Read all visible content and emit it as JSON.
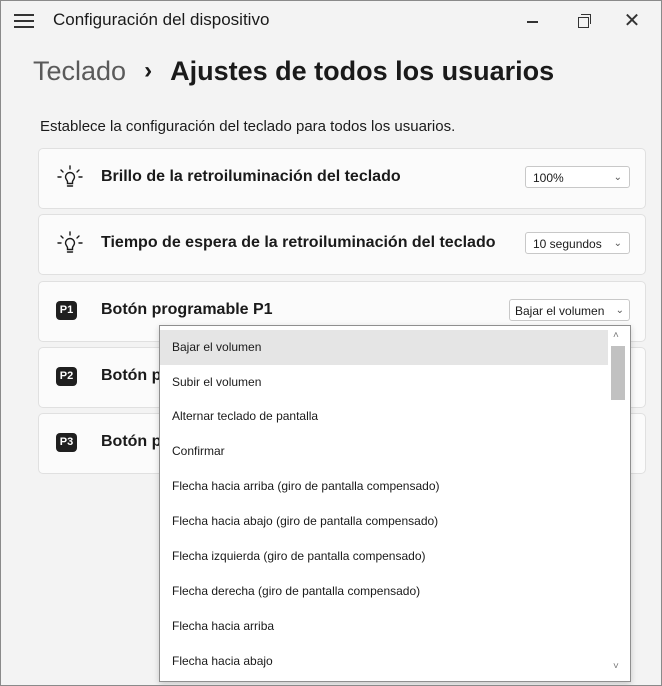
{
  "titlebar": {
    "app_title": "Configuración del dispositivo",
    "minimize_glyph": "–",
    "close_glyph": "✕"
  },
  "breadcrumb": {
    "parent": "Teclado",
    "separator": "›",
    "current": "Ajustes de todos los usuarios"
  },
  "description": "Establece la configuración del teclado para todos los usuarios.",
  "settings": [
    {
      "icon": "lightbulb-icon",
      "label": "Brillo de la retroiluminación del teclado",
      "value": "100%"
    },
    {
      "icon": "lightbulb-icon",
      "label": "Tiempo de espera de la retroiluminación del teclado",
      "value": "10 segundos"
    },
    {
      "icon": "p1-key-icon",
      "key_label": "P1",
      "label": "Botón programable P1",
      "value": "Bajar el volumen"
    },
    {
      "icon": "p2-key-icon",
      "key_label": "P2",
      "label": "Botón p"
    },
    {
      "icon": "p3-key-icon",
      "key_label": "P3",
      "label": "Botón p"
    }
  ],
  "chevron_glyph": "⌄",
  "dropdown": {
    "selected_index": 0,
    "options": [
      "Bajar el volumen",
      "Subir el volumen",
      "Alternar teclado de pantalla",
      "Confirmar",
      "Flecha hacia arriba (giro de pantalla compensado)",
      "Flecha hacia abajo (giro de pantalla compensado)",
      "Flecha izquierda (giro de pantalla compensado)",
      "Flecha derecha (giro de pantalla compensado)",
      "Flecha hacia arriba",
      "Flecha hacia abajo"
    ],
    "scroll_up_glyph": "˄",
    "scroll_down_glyph": "˅"
  },
  "colors": {
    "window_bg": "#f3f3f3",
    "card_bg": "#fbfbfb",
    "selected_option_bg": "#e5e5e5"
  }
}
